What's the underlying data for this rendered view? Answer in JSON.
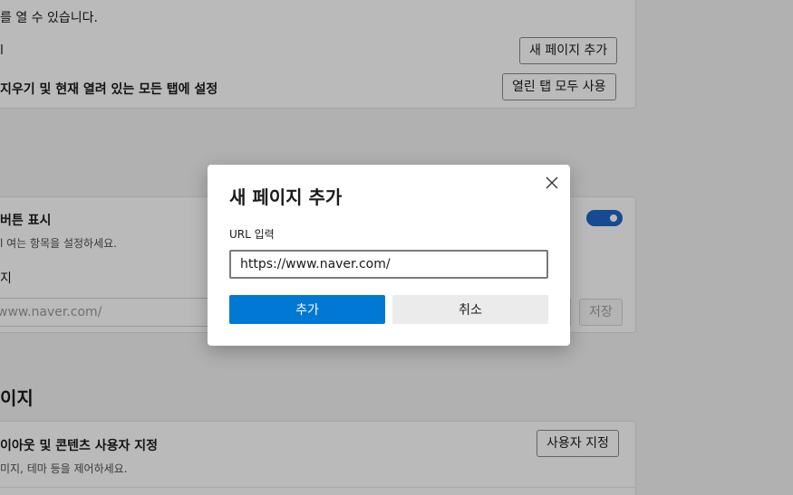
{
  "background": {
    "card1": {
      "line1": "를 열 수 있습니다.",
      "line2": "l",
      "line3": "지우기 및 현재 열려 있는 모든 탭에 설정",
      "add_page_button": "새 페이지 추가",
      "use_open_tabs_button": "열린 탭 모두 사용"
    },
    "card2": {
      "title": "버튼 표시",
      "subtitle": "l 여는 항목을 설정하세요.",
      "row_label": "지",
      "url_placeholder": "www.naver.com/",
      "save_button": "저장",
      "toggle_on": true
    },
    "section_heading": "이지",
    "card3": {
      "title": "이아웃 및 콘텐츠 사용자 지정",
      "subtitle": "미지, 테마 등을 제어하세요.",
      "customize_button": "사용자 지정"
    }
  },
  "dialog": {
    "title": "새 페이지 추가",
    "url_label": "URL 입력",
    "url_value": "https://www.naver.com/",
    "add_button": "추가",
    "cancel_button": "취소",
    "close_icon": "close-icon"
  },
  "colors": {
    "primary": "#0078d4",
    "toggle": "#1f68c7",
    "overlay": "rgba(0,0,0,0.27)"
  }
}
